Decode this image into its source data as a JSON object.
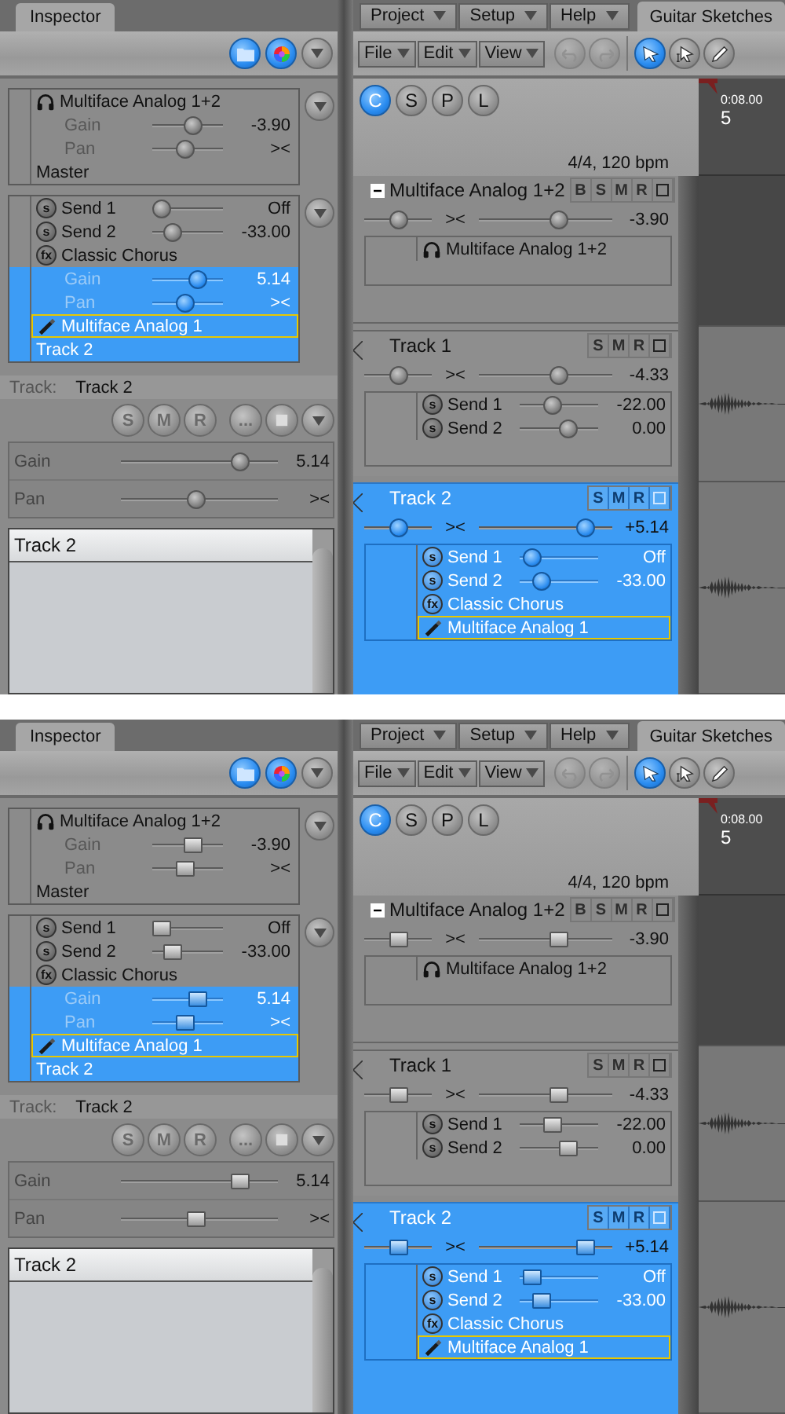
{
  "panels": [
    {
      "kind": "round",
      "inspector_tab": {
        "label": "Inspector",
        "selected": true
      },
      "menus": [
        {
          "label": "Project"
        },
        {
          "label": "Setup"
        },
        {
          "label": "Help"
        }
      ],
      "document_tab": {
        "label": "Guitar Sketches",
        "selected": true
      },
      "edit_menus": [
        {
          "label": "File"
        },
        {
          "label": "Edit"
        },
        {
          "label": "View"
        }
      ],
      "history_buttons": [
        {
          "kind": "undo",
          "disabled": true
        },
        {
          "kind": "redo",
          "disabled": true
        }
      ],
      "tools": [
        {
          "kind": "select",
          "selected": true
        },
        {
          "kind": "range",
          "selected": false
        },
        {
          "kind": "pencil",
          "selected": false
        }
      ],
      "inspector": {
        "groups": [
          {
            "items": [
              {
                "kind": "output",
                "label": "Multiface Analog 1+2",
                "selected": false
              },
              {
                "kind": "slider",
                "label": "Gain",
                "value": "-3.90",
                "level": 0.6,
                "selected": false
              },
              {
                "kind": "slider",
                "label": "Pan",
                "value": "><",
                "level": 0.45,
                "selected": false
              },
              {
                "kind": "name",
                "label": "Master",
                "selected": false
              }
            ]
          },
          {
            "items": [
              {
                "kind": "send",
                "badge": "s",
                "label": "Send 1",
                "value": "Off",
                "level": 0,
                "selected": false
              },
              {
                "kind": "send",
                "badge": "s",
                "label": "Send 2",
                "value": "-33.00",
                "level": 0.2,
                "selected": false
              },
              {
                "kind": "insert",
                "badge": "fx",
                "label": "Classic Chorus",
                "selected": false
              },
              {
                "kind": "slider",
                "label": "Gain",
                "value": "5.14",
                "level": 0.7,
                "selected": true
              },
              {
                "kind": "slider",
                "label": "Pan",
                "value": "><",
                "level": 0.45,
                "selected": true
              },
              {
                "kind": "input",
                "label": "Multiface Analog 1",
                "selected": true
              },
              {
                "kind": "name",
                "label": "Track 2",
                "selected": true
              }
            ]
          }
        ],
        "track_label": "Track:",
        "track_name": "Track 2",
        "track_buttons": [
          {
            "label": "S"
          },
          {
            "label": "M"
          },
          {
            "label": "R"
          },
          {
            "label": "..."
          }
        ],
        "controls": [
          {
            "label": "Gain",
            "value": "5.14",
            "level": 0.8
          },
          {
            "label": "Pan",
            "value": "><",
            "level": 0.48
          }
        ],
        "list": [
          {
            "label": "Track 2",
            "selected": true
          }
        ]
      },
      "view_buttons": [
        {
          "label": "C",
          "selected": true
        },
        {
          "label": "S",
          "selected": false
        },
        {
          "label": "P",
          "selected": false
        },
        {
          "label": "L",
          "selected": false
        }
      ],
      "tempo": "4/4, 120 bpm",
      "ruler": {
        "time": "0:08.00",
        "bar": "5"
      },
      "channels": [
        {
          "kind": "bus",
          "name": "Multiface Analog 1+2",
          "selected": false,
          "buttons": [
            {
              "label": "B"
            },
            {
              "label": "S"
            },
            {
              "label": "M"
            },
            {
              "label": "R"
            }
          ],
          "pan": {
            "value": "><",
            "level": 0.5
          },
          "volume": {
            "value": "-3.90",
            "level": 0.62
          },
          "items": [
            {
              "kind": "output",
              "label": "Multiface Analog 1+2",
              "selected": false
            }
          ]
        },
        {
          "kind": "track",
          "name": "Track 1",
          "selected": false,
          "buttons": [
            {
              "label": "S"
            },
            {
              "label": "M"
            },
            {
              "label": "R"
            }
          ],
          "pan": {
            "value": "><",
            "level": 0.5
          },
          "volume": {
            "value": "-4.33",
            "level": 0.62
          },
          "items": [
            {
              "kind": "send",
              "badge": "s",
              "label": "Send 1",
              "value": "-22.00",
              "level": 0.4,
              "selected": false
            },
            {
              "kind": "send",
              "badge": "s",
              "label": "Send 2",
              "value": "0.00",
              "level": 0.65,
              "selected": false
            }
          ]
        },
        {
          "kind": "track",
          "name": "Track 2",
          "selected": true,
          "buttons": [
            {
              "label": "S"
            },
            {
              "label": "M"
            },
            {
              "label": "R"
            }
          ],
          "pan": {
            "value": "><",
            "level": 0.5
          },
          "volume": {
            "value": "+5.14",
            "level": 0.85
          },
          "items": [
            {
              "kind": "send",
              "badge": "s",
              "label": "Send 1",
              "value": "Off",
              "level": 0.05,
              "selected": true
            },
            {
              "kind": "send",
              "badge": "s",
              "label": "Send 2",
              "value": "-33.00",
              "level": 0.2,
              "selected": true
            },
            {
              "kind": "insert",
              "badge": "fx",
              "label": "Classic Chorus",
              "selected": true
            },
            {
              "kind": "input",
              "label": "Multiface Analog 1",
              "selected": true
            }
          ]
        }
      ]
    },
    {
      "kind": "square",
      "inspector_tab": {
        "label": "Inspector",
        "selected": true
      },
      "menus": [
        {
          "label": "Project"
        },
        {
          "label": "Setup"
        },
        {
          "label": "Help"
        }
      ],
      "document_tab": {
        "label": "Guitar Sketches",
        "selected": true
      },
      "edit_menus": [
        {
          "label": "File"
        },
        {
          "label": "Edit"
        },
        {
          "label": "View"
        }
      ],
      "history_buttons": [
        {
          "kind": "undo",
          "disabled": true
        },
        {
          "kind": "redo",
          "disabled": true
        }
      ],
      "tools": [
        {
          "kind": "select",
          "selected": true
        },
        {
          "kind": "range",
          "selected": false
        },
        {
          "kind": "pencil",
          "selected": false
        }
      ],
      "inspector": {
        "groups": [
          {
            "items": [
              {
                "kind": "output",
                "label": "Multiface Analog 1+2",
                "selected": false
              },
              {
                "kind": "slider",
                "label": "Gain",
                "value": "-3.90",
                "level": 0.6,
                "selected": false
              },
              {
                "kind": "slider",
                "label": "Pan",
                "value": "><",
                "level": 0.45,
                "selected": false
              },
              {
                "kind": "name",
                "label": "Master",
                "selected": false
              }
            ]
          },
          {
            "items": [
              {
                "kind": "send",
                "badge": "s",
                "label": "Send 1",
                "value": "Off",
                "level": 0,
                "selected": false
              },
              {
                "kind": "send",
                "badge": "s",
                "label": "Send 2",
                "value": "-33.00",
                "level": 0.2,
                "selected": false
              },
              {
                "kind": "insert",
                "badge": "fx",
                "label": "Classic Chorus",
                "selected": false
              },
              {
                "kind": "slider",
                "label": "Gain",
                "value": "5.14",
                "level": 0.7,
                "selected": true
              },
              {
                "kind": "slider",
                "label": "Pan",
                "value": "><",
                "level": 0.45,
                "selected": true
              },
              {
                "kind": "input",
                "label": "Multiface Analog 1",
                "selected": true
              },
              {
                "kind": "name",
                "label": "Track 2",
                "selected": true
              }
            ]
          }
        ],
        "track_label": "Track:",
        "track_name": "Track 2",
        "track_buttons": [
          {
            "label": "S"
          },
          {
            "label": "M"
          },
          {
            "label": "R"
          },
          {
            "label": "..."
          }
        ],
        "controls": [
          {
            "label": "Gain",
            "value": "5.14",
            "level": 0.8
          },
          {
            "label": "Pan",
            "value": "><",
            "level": 0.48
          }
        ],
        "list": [
          {
            "label": "Track 2",
            "selected": true
          }
        ]
      },
      "view_buttons": [
        {
          "label": "C",
          "selected": true
        },
        {
          "label": "S",
          "selected": false
        },
        {
          "label": "P",
          "selected": false
        },
        {
          "label": "L",
          "selected": false
        }
      ],
      "tempo": "4/4, 120 bpm",
      "ruler": {
        "time": "0:08.00",
        "bar": "5"
      },
      "channels": [
        {
          "kind": "bus",
          "name": "Multiface Analog 1+2",
          "selected": false,
          "buttons": [
            {
              "label": "B"
            },
            {
              "label": "S"
            },
            {
              "label": "M"
            },
            {
              "label": "R"
            }
          ],
          "pan": {
            "value": "><",
            "level": 0.5
          },
          "volume": {
            "value": "-3.90",
            "level": 0.62
          },
          "items": [
            {
              "kind": "output",
              "label": "Multiface Analog 1+2",
              "selected": false
            }
          ]
        },
        {
          "kind": "track",
          "name": "Track 1",
          "selected": false,
          "buttons": [
            {
              "label": "S"
            },
            {
              "label": "M"
            },
            {
              "label": "R"
            }
          ],
          "pan": {
            "value": "><",
            "level": 0.5
          },
          "volume": {
            "value": "-4.33",
            "level": 0.62
          },
          "items": [
            {
              "kind": "send",
              "badge": "s",
              "label": "Send 1",
              "value": "-22.00",
              "level": 0.4,
              "selected": false
            },
            {
              "kind": "send",
              "badge": "s",
              "label": "Send 2",
              "value": "0.00",
              "level": 0.65,
              "selected": false
            }
          ]
        },
        {
          "kind": "track",
          "name": "Track 2",
          "selected": true,
          "buttons": [
            {
              "label": "S"
            },
            {
              "label": "M"
            },
            {
              "label": "R"
            }
          ],
          "pan": {
            "value": "><",
            "level": 0.5
          },
          "volume": {
            "value": "+5.14",
            "level": 0.85
          },
          "items": [
            {
              "kind": "send",
              "badge": "s",
              "label": "Send 1",
              "value": "Off",
              "level": 0.05,
              "selected": true
            },
            {
              "kind": "send",
              "badge": "s",
              "label": "Send 2",
              "value": "-33.00",
              "level": 0.2,
              "selected": true
            },
            {
              "kind": "insert",
              "badge": "fx",
              "label": "Classic Chorus",
              "selected": true
            },
            {
              "kind": "input",
              "label": "Multiface Analog 1",
              "selected": true
            }
          ]
        }
      ]
    }
  ]
}
